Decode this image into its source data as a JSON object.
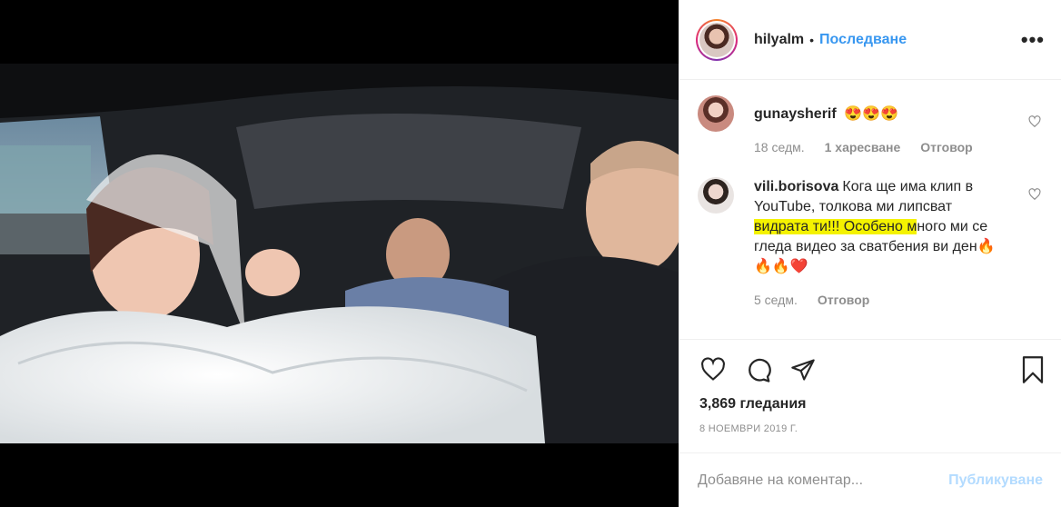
{
  "header": {
    "username": "hilyalm",
    "separator": "•",
    "follow_label": "Последване",
    "more_label": "•••"
  },
  "comments": [
    {
      "username": "gunaysherif",
      "text_before": "",
      "emoji": "😍😍😍",
      "time": "18 седм.",
      "likes": "1 харесване",
      "reply": "Отговор"
    },
    {
      "username": "vili.borisova",
      "text_before": "Кога ще има клип в YouTube, толкова ми липсват ",
      "text_highlight": "видрата ти!!! Особено м",
      "text_after": "ного ми се гледа видео за сватбения ви ден",
      "emoji": "🔥🔥🔥❤️",
      "time": "5 седм.",
      "reply": "Отговор"
    }
  ],
  "stats": {
    "views": "3,869 гледания",
    "date": "8 НОЕМВРИ 2019 Г."
  },
  "add_comment": {
    "placeholder": "Добавяне на коментар...",
    "publish_label": "Публикуване"
  }
}
